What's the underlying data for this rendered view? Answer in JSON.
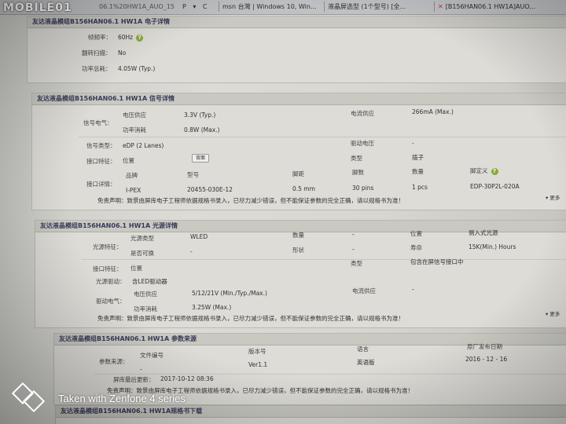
{
  "brand": "MOBILE01",
  "tabs": {
    "url": "06.1%20HW1A_AUO_15",
    "nav": "P ▾ C",
    "t1": "msn 台灣 | Windows 10, Win...",
    "t2": "液晶屏选型 (1个型号) [全...",
    "t3": "[B156HAN06.1 HW1A]AUO..."
  },
  "elec_tail": {
    "title": "友达液晶模组B156HAN06.1 HW1A 电子详情",
    "rows": [
      {
        "label": "帧频率：",
        "value": "60Hz"
      },
      {
        "label": "翻转扫描：",
        "value": "No"
      },
      {
        "label": "功率总耗：",
        "value": "4.05W (Typ.)"
      }
    ]
  },
  "signal": {
    "title": "友达液晶模组B156HAN06.1 HW1A 信号详情",
    "elec_label": "信号电气：",
    "supply_label": "电压供应",
    "supply_value": "3.3V (Typ.)",
    "consume_label": "功率消耗",
    "consume_value": "0.8W (Max.)",
    "current_label": "电流供应",
    "current_value": "266mA (Max.)",
    "type_label": "信号类型：",
    "type_value": "eDP (2 Lanes)",
    "drive_label": "驱动电压",
    "drive_value": "-",
    "iface_label": "接口特征：",
    "pos_label": "位置",
    "pos_btn": "背面",
    "kind_label": "类型",
    "kind_value": "插子",
    "detail_label": "接口详情：",
    "headers": [
      "品牌",
      "型号",
      "脚距",
      "脚数",
      "数量",
      "脚定义"
    ],
    "row": [
      "I-PEX",
      "20455-030E-12",
      "0.5 mm",
      "30 pins",
      "1 pcs",
      "EDP-30P2L-020A"
    ],
    "disclaimer": "免责声明：致景由屏库电子工程师依据规格书录入，已尽力减少错误，但不能保证参数的完全正确，请以规格书为准！",
    "more": "▾ 更多"
  },
  "backlight": {
    "title": "友达液晶模组B156HAN06.1 HW1A 光源详情",
    "feat_label": "光源特征：",
    "src_label": "光源类型",
    "src_value": "WLED",
    "count_label": "数量",
    "count_value": "-",
    "pos_label": "位置",
    "pos_value": "侧入式光源",
    "replace_label": "是否可换",
    "replace_value": "-",
    "shape_label": "形状",
    "shape_value": "-",
    "life_label": "寿命",
    "life_value": "15K(Min.) Hours",
    "iface_label": "接口特征：",
    "iface_pos": "位置",
    "iface_type_label": "类型",
    "iface_type_value": "包含在屏信号接口中",
    "drv_label": "光源驱动：",
    "drv_value": "含LED驱动器",
    "elec_label": "驱动电气：",
    "supply_label": "电压供应",
    "supply_value": "5/12/21V (Min./Typ./Max.)",
    "current_label": "电流供应",
    "current_value": "-",
    "consume_label": "功率消耗",
    "consume_value": "3.25W (Max.)",
    "disclaimer": "免责声明：致景由屏库电子工程师依据规格书录入，已尽力减少错误，但不能保证参数的完全正确，请以规格书为准！",
    "more": "▾ 更多"
  },
  "source": {
    "title": "友达液晶模组B156HAN06.1 HW1A 参数来源",
    "ref_label": "参数来源：",
    "headers": [
      "文件编号",
      "版本号",
      "语言",
      "原厂发布日期"
    ],
    "row": [
      "-",
      "Ver1.1",
      "英语版",
      "2016 - 12 - 16"
    ],
    "update_label": "屏库最后更新：",
    "update_value": "2017-10-12 08:36",
    "disclaimer": "免责声明：致景由屏库电子工程师依据规格书录入，已尽力减少错误，但不能保证参数的完全正确，请以规格书为准！",
    "next_title": "友达液晶模组B156HAN06.1 HW1A规格书下载"
  },
  "watermark": "Taken with Zenfone 4 series"
}
